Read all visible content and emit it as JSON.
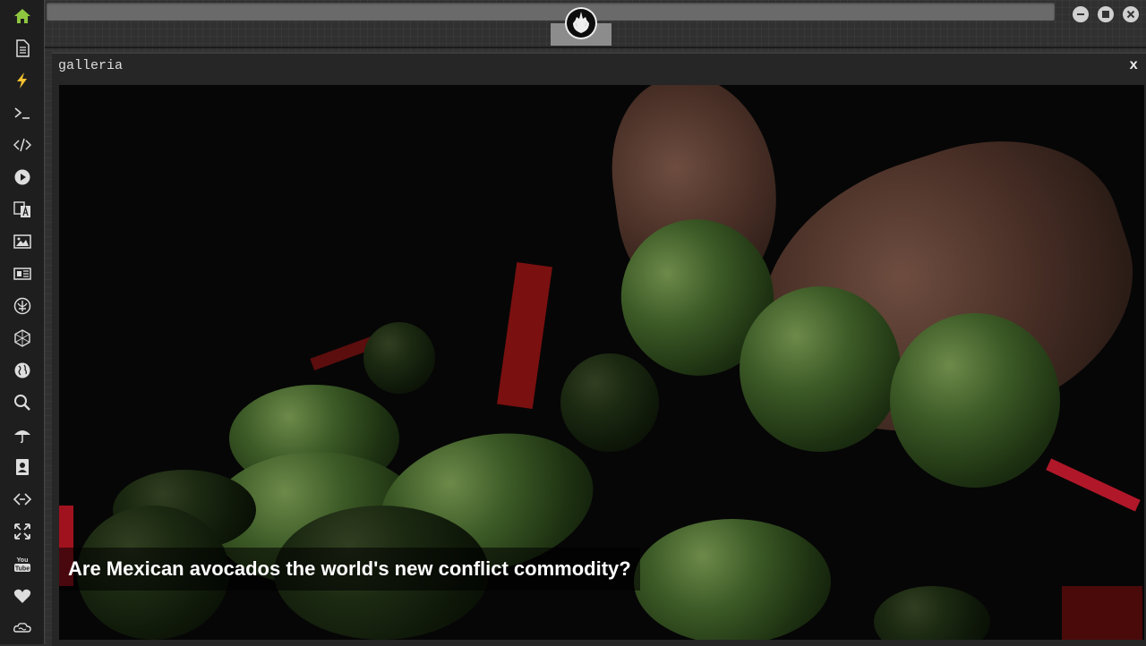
{
  "sidebar": {
    "items": [
      {
        "name": "home-icon",
        "color": "#8ec63f"
      },
      {
        "name": "document-icon"
      },
      {
        "name": "lightning-icon",
        "color": "#f2c230"
      },
      {
        "name": "terminal-icon"
      },
      {
        "name": "code-icon"
      },
      {
        "name": "play-icon"
      },
      {
        "name": "translate-icon"
      },
      {
        "name": "image-icon"
      },
      {
        "name": "newspaper-icon"
      },
      {
        "name": "rebel-alliance-icon"
      },
      {
        "name": "hexagon-icon"
      },
      {
        "name": "globe-icon"
      },
      {
        "name": "search-icon"
      },
      {
        "name": "umbrella-icon"
      },
      {
        "name": "contacts-icon"
      },
      {
        "name": "link-icon"
      },
      {
        "name": "expand-icon"
      },
      {
        "name": "youtube-icon",
        "label": "You Tube"
      },
      {
        "name": "heart-icon"
      },
      {
        "name": "infinity-cloud-icon"
      }
    ]
  },
  "header": {
    "emblem_icon": "rebel-alliance-icon",
    "controls": [
      "minimize-icon",
      "maximize-icon",
      "close-icon"
    ]
  },
  "window": {
    "title": "galleria",
    "close_label": "x"
  },
  "gallery": {
    "caption": "Are Mexican avocados the world's new conflict commodity?"
  }
}
